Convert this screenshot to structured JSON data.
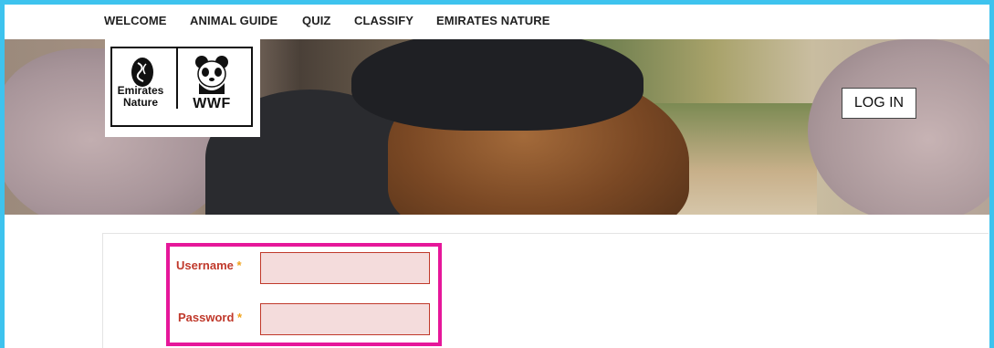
{
  "nav": {
    "items": [
      {
        "label": "WELCOME"
      },
      {
        "label": "ANIMAL GUIDE"
      },
      {
        "label": "QUIZ"
      },
      {
        "label": "CLASSIFY"
      },
      {
        "label": "EMIRATES NATURE"
      }
    ]
  },
  "logo": {
    "partner_line1": "Emirates",
    "partner_line2": "Nature",
    "brand": "WWF"
  },
  "header": {
    "login_label": "LOG IN"
  },
  "form": {
    "username": {
      "label": "Username",
      "required_mark": "*",
      "value": ""
    },
    "password": {
      "label": "Password",
      "required_mark": "*",
      "value": ""
    }
  },
  "colors": {
    "frame": "#3ec3ee",
    "highlight": "#e6179a",
    "label": "#c0392b",
    "required": "#f0a21a",
    "input_bg": "#f4dcdc"
  }
}
